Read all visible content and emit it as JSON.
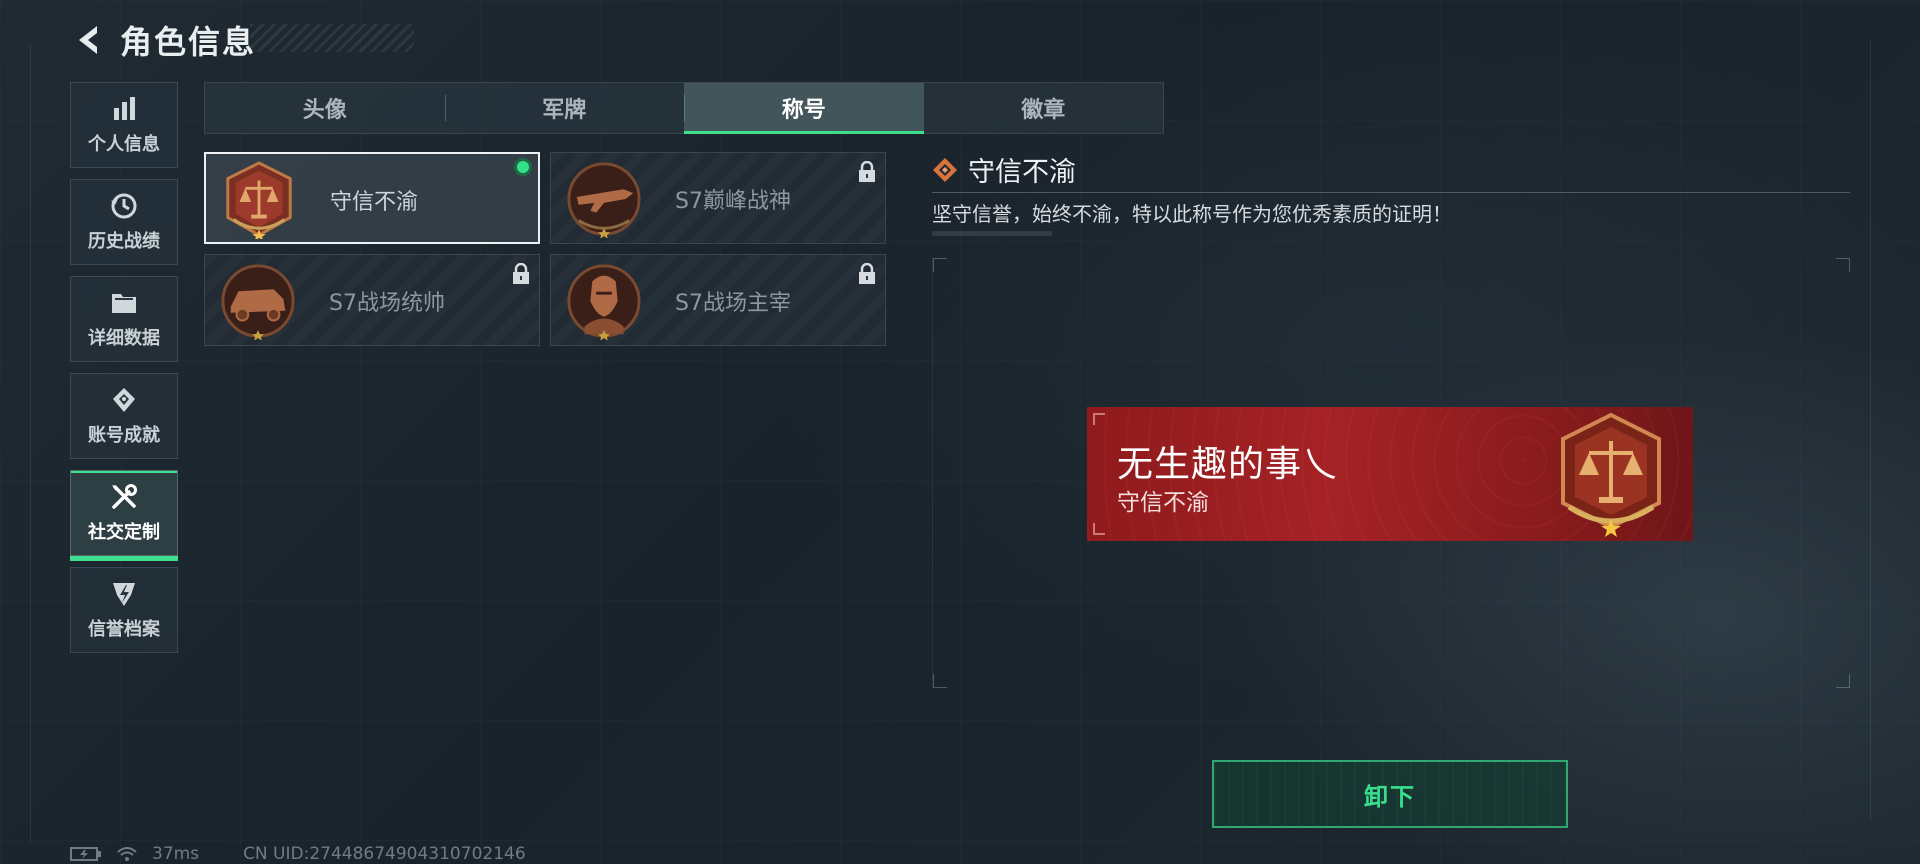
{
  "header": {
    "title": "角色信息"
  },
  "sidebar": {
    "items": [
      {
        "label": "个人信息",
        "icon": "bar-chart-icon",
        "active": false
      },
      {
        "label": "历史战绩",
        "icon": "history-clock-icon",
        "active": false
      },
      {
        "label": "详细数据",
        "icon": "folder-icon",
        "active": false
      },
      {
        "label": "账号成就",
        "icon": "achievement-icon",
        "active": false
      },
      {
        "label": "社交定制",
        "icon": "tools-icon",
        "active": true
      },
      {
        "label": "信誉档案",
        "icon": "reputation-icon",
        "active": false
      }
    ]
  },
  "tabs": [
    {
      "label": "头像",
      "active": false
    },
    {
      "label": "军牌",
      "active": false
    },
    {
      "label": "称号",
      "active": true
    },
    {
      "label": "徽章",
      "active": false
    }
  ],
  "titles": [
    {
      "label": "守信不渝",
      "selected": true,
      "locked": false,
      "emblem": "scales-emblem-icon"
    },
    {
      "label": "S7巅峰战神",
      "selected": false,
      "locked": true,
      "emblem": "rifle-emblem-icon"
    },
    {
      "label": "S7战场统帅",
      "selected": false,
      "locked": true,
      "emblem": "vehicle-emblem-icon"
    },
    {
      "label": "S7战场主宰",
      "selected": false,
      "locked": true,
      "emblem": "soldier-emblem-icon"
    }
  ],
  "detail": {
    "title": "守信不渝",
    "description": "坚守信誉，始终不渝，特以此称号作为您优秀素质的证明！"
  },
  "nameplate": {
    "player_name": "无生趣的事乀",
    "title": "守信不渝"
  },
  "actions": {
    "unequip_label": "卸下"
  },
  "status": {
    "ping": "37ms",
    "uid": "CN UID:27448674904310702146"
  },
  "colors": {
    "accent_green": "#3ee08f",
    "emblem_bronze": "#c07a45",
    "nameplate_red": "#a52225"
  }
}
